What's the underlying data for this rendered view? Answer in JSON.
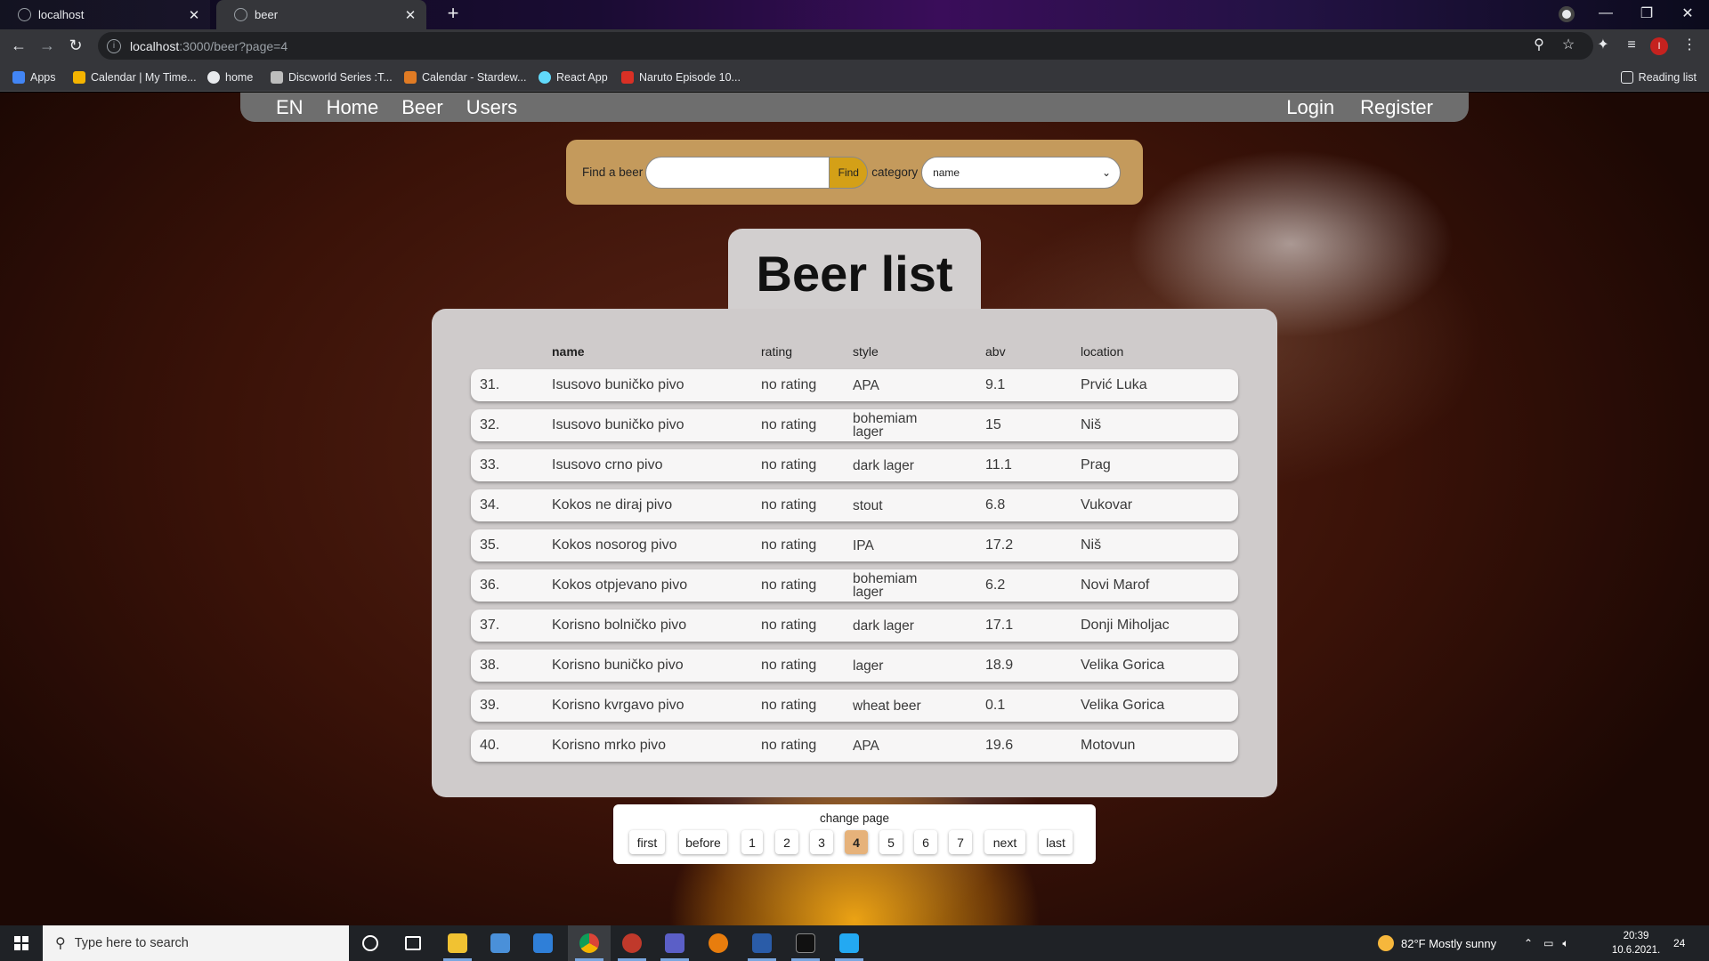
{
  "browser": {
    "tabs": [
      {
        "title": "localhost",
        "active": false
      },
      {
        "title": "beer",
        "active": true
      }
    ],
    "url_host": "localhost",
    "url_path": ":3000/beer?page=4",
    "bookmarks": [
      {
        "label": "Apps",
        "color": "#4285f4"
      },
      {
        "label": "Calendar | My Time...",
        "color": "#f4b400"
      },
      {
        "label": "home",
        "color": "#e8eaed"
      },
      {
        "label": "Discworld Series :T...",
        "color": "#bdbdbd"
      },
      {
        "label": "Calendar - Stardew...",
        "color": "#e07b24"
      },
      {
        "label": "React App",
        "color": "#61dafb"
      },
      {
        "label": "Naruto Episode 10...",
        "color": "#d93025"
      }
    ],
    "reading_list": "Reading list",
    "profile_initial": "I"
  },
  "nav": {
    "lang": "EN",
    "home": "Home",
    "beer": "Beer",
    "users": "Users",
    "login": "Login",
    "register": "Register"
  },
  "search": {
    "label": "Find a beer",
    "value": "",
    "button": "Find",
    "category_label": "category",
    "category_value": "name"
  },
  "title": "Beer list",
  "table": {
    "headers": {
      "name": "name",
      "rating": "rating",
      "style": "style",
      "abv": "abv",
      "location": "location"
    },
    "rows": [
      {
        "num": "31.",
        "name": "Isusovo buničko pivo",
        "rating": "no rating",
        "style": "APA",
        "abv": "9.1",
        "location": "Prvić Luka"
      },
      {
        "num": "32.",
        "name": "Isusovo buničko pivo",
        "rating": "no rating",
        "style": "bohemiam lager",
        "abv": "15",
        "location": "Niš"
      },
      {
        "num": "33.",
        "name": "Isusovo crno pivo",
        "rating": "no rating",
        "style": "dark lager",
        "abv": "11.1",
        "location": "Prag"
      },
      {
        "num": "34.",
        "name": "Kokos ne diraj pivo",
        "rating": "no rating",
        "style": "stout",
        "abv": "6.8",
        "location": "Vukovar"
      },
      {
        "num": "35.",
        "name": "Kokos nosorog pivo",
        "rating": "no rating",
        "style": "IPA",
        "abv": "17.2",
        "location": "Niš"
      },
      {
        "num": "36.",
        "name": "Kokos otpjevano pivo",
        "rating": "no rating",
        "style": "bohemiam lager",
        "abv": "6.2",
        "location": "Novi Marof"
      },
      {
        "num": "37.",
        "name": "Korisno bolničko pivo",
        "rating": "no rating",
        "style": "dark lager",
        "abv": "17.1",
        "location": "Donji Miholjac"
      },
      {
        "num": "38.",
        "name": "Korisno buničko pivo",
        "rating": "no rating",
        "style": "lager",
        "abv": "18.9",
        "location": "Velika Gorica"
      },
      {
        "num": "39.",
        "name": "Korisno kvrgavo pivo",
        "rating": "no rating",
        "style": "wheat beer",
        "abv": "0.1",
        "location": "Velika Gorica"
      },
      {
        "num": "40.",
        "name": "Korisno mrko pivo",
        "rating": "no rating",
        "style": "APA",
        "abv": "19.6",
        "location": "Motovun"
      }
    ]
  },
  "pager": {
    "label": "change page",
    "buttons": [
      "first",
      "before",
      "1",
      "2",
      "3",
      "4",
      "5",
      "6",
      "7",
      "next",
      "last"
    ],
    "current": "4"
  },
  "taskbar": {
    "search_placeholder": "Type here to search",
    "weather": "82°F  Mostly sunny",
    "time": "20:39",
    "date": "10.6.2021.",
    "notifications": "24"
  }
}
